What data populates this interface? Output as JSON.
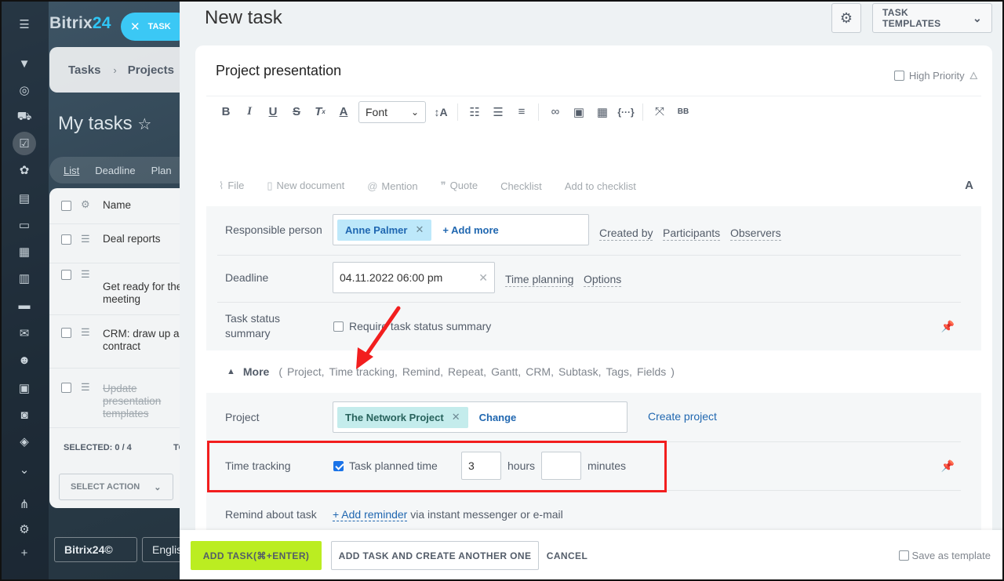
{
  "background": {
    "brand": {
      "name": "Bitrix",
      "suffix": "24"
    },
    "task_button": "TASK",
    "nav": {
      "tasks": "Tasks",
      "projects": "Projects"
    },
    "page_title": "My tasks",
    "filters": [
      "List",
      "Deadline",
      "Plan"
    ],
    "list": {
      "header": "Name",
      "rows": [
        {
          "name": "Deal reports",
          "done": false
        },
        {
          "name": "Get ready for the meeting",
          "done": false
        },
        {
          "name": "CRM: draw up a contract",
          "done": false
        },
        {
          "name": "Update presentation templates",
          "done": true
        }
      ],
      "selected": "SELECTED: 0 / 4",
      "total": "TO",
      "select_action": "SELECT ACTION"
    },
    "bottom": {
      "brand": "Bitrix24©",
      "language": "English"
    }
  },
  "slider": {
    "title": "New task",
    "templates_label": "TASK TEMPLATES",
    "task_name": "Project presentation",
    "high_priority": "High Priority",
    "editor": {
      "font_label": "Font"
    },
    "attach": {
      "file": "File",
      "new_document": "New document",
      "mention": "Mention",
      "quote": "Quote",
      "checklist": "Checklist",
      "add_to_checklist": "Add to checklist"
    },
    "responsible": {
      "label": "Responsible person",
      "person": "Anne Palmer",
      "add_more": "+ Add more",
      "links": {
        "created_by": "Created by",
        "participants": "Participants",
        "observers": "Observers"
      }
    },
    "deadline": {
      "label": "Deadline",
      "value": "04.11.2022 06:00 pm",
      "time_planning": "Time planning",
      "options": "Options"
    },
    "status_summary": {
      "label_line1": "Task status",
      "label_line2": "summary",
      "checkbox_label": "Require task status summary"
    },
    "more": {
      "title": "More",
      "open_paren": "(",
      "items": [
        "Project,",
        "Time tracking,",
        "Remind,",
        "Repeat,",
        "Gantt,",
        "CRM,",
        "Subtask,",
        "Tags,",
        "Fields"
      ],
      "close_paren": ")"
    },
    "project": {
      "label": "Project",
      "value": "The Network Project",
      "change": "Change",
      "create": "Create project"
    },
    "time_tracking": {
      "label": "Time tracking",
      "checkbox_label": "Task planned time",
      "checked": true,
      "hours_value": "3",
      "hours_label": "hours",
      "minutes_value": "",
      "minutes_label": "minutes"
    },
    "remind": {
      "label": "Remind about task",
      "add_reminder": "+ Add reminder",
      "via": "via instant messenger or e-mail"
    },
    "actions": {
      "add_task": "ADD TASK(⌘+ENTER)",
      "add_another": "ADD TASK AND CREATE ANOTHER ONE",
      "cancel": "CANCEL",
      "save_template": "Save as template"
    }
  },
  "colors": {
    "accent": "#2fc6f6",
    "primary_button": "#bbed21",
    "highlight": "#f21e1e",
    "link": "#2067b0"
  }
}
